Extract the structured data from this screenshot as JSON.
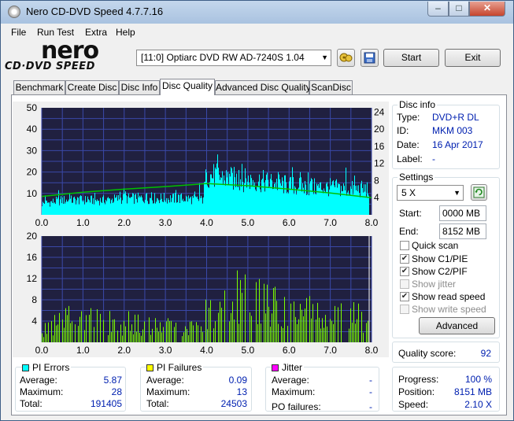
{
  "window": {
    "title": "Nero CD-DVD Speed 4.7.7.16"
  },
  "menu": [
    "File",
    "Run Test",
    "Extra",
    "Help"
  ],
  "logo": {
    "top": "nero",
    "bottom": "CD·DVD SPEED"
  },
  "toolbar": {
    "drive": "[11:0]  Optiarc DVD RW AD-7240S 1.04",
    "start_label": "Start",
    "exit_label": "Exit"
  },
  "tabs": [
    "Benchmark",
    "Create Disc",
    "Disc Info",
    "Disc Quality",
    "Advanced Disc Quality",
    "ScanDisc"
  ],
  "active_tab": "Disc Quality",
  "disc_info": {
    "title": "Disc info",
    "type_label": "Type:",
    "type_value": "DVD+R DL",
    "id_label": "ID:",
    "id_value": "MKM 003",
    "date_label": "Date:",
    "date_value": "16 Apr 2017",
    "label_label": "Label:",
    "label_value": "-"
  },
  "settings": {
    "title": "Settings",
    "speed": "5 X",
    "start_label": "Start:",
    "start_value": "0000 MB",
    "end_label": "End:",
    "end_value": "8152 MB",
    "checks": [
      {
        "label": "Quick scan",
        "checked": false,
        "enabled": true
      },
      {
        "label": "Show C1/PIE",
        "checked": true,
        "enabled": true
      },
      {
        "label": "Show C2/PIF",
        "checked": true,
        "enabled": true
      },
      {
        "label": "Show jitter",
        "checked": false,
        "enabled": false
      },
      {
        "label": "Show read speed",
        "checked": true,
        "enabled": true
      },
      {
        "label": "Show write speed",
        "checked": false,
        "enabled": false
      }
    ],
    "advanced_label": "Advanced"
  },
  "quality": {
    "label": "Quality score:",
    "value": "92"
  },
  "progress": {
    "progress_label": "Progress:",
    "progress_value": "100 %",
    "position_label": "Position:",
    "position_value": "8151 MB",
    "speed_label": "Speed:",
    "speed_value": "2.10 X"
  },
  "stats": {
    "pi_errors": {
      "title": "PI Errors",
      "color": "#00ffff",
      "average_label": "Average:",
      "average": "5.87",
      "maximum_label": "Maximum:",
      "maximum": "28",
      "total_label": "Total:",
      "total": "191405"
    },
    "pi_failures": {
      "title": "PI Failures",
      "color": "#ffff00",
      "average_label": "Average:",
      "average": "0.09",
      "maximum_label": "Maximum:",
      "maximum": "13",
      "total_label": "Total:",
      "total": "24503"
    },
    "jitter": {
      "title": "Jitter",
      "color": "#ff00ff",
      "average_label": "Average:",
      "average": "-",
      "maximum_label": "Maximum:",
      "maximum": "-",
      "po_label": "PO failures:",
      "po_value": "-"
    }
  },
  "chart_data": [
    {
      "type": "area",
      "title": "",
      "x_ticks": [
        "0.0",
        "1.0",
        "2.0",
        "3.0",
        "4.0",
        "5.0",
        "6.0",
        "7.0",
        "8.0"
      ],
      "y_left_ticks": [
        "10",
        "20",
        "30",
        "40",
        "50"
      ],
      "y_right_ticks": [
        "4",
        "8",
        "12",
        "16",
        "20",
        "24"
      ],
      "xlim": [
        0,
        8.0
      ],
      "ylim_left": [
        0,
        50
      ],
      "ylim_right": [
        0,
        25
      ],
      "grid": true,
      "series": [
        {
          "color": "#00ffff",
          "x": [
            0.0,
            0.5,
            1.0,
            1.5,
            2.0,
            2.5,
            3.0,
            3.5,
            3.9,
            4.0,
            4.5,
            5.0,
            5.5,
            6.0,
            6.5,
            7.0,
            7.5,
            8.0
          ],
          "y": [
            6,
            8,
            8,
            8,
            9,
            9,
            9,
            9,
            8,
            22,
            20,
            19,
            18,
            16,
            15,
            15,
            14,
            14
          ]
        },
        {
          "color": "#00c000",
          "x": [
            0.0,
            1.0,
            2.0,
            3.0,
            4.0,
            5.0,
            6.0,
            7.0,
            8.0
          ],
          "y": [
            4.3,
            5.3,
            6.0,
            6.6,
            7.3,
            6.8,
            6.0,
            5.1,
            4.0
          ]
        }
      ]
    },
    {
      "type": "bar",
      "title": "",
      "x_ticks": [
        "0.0",
        "1.0",
        "2.0",
        "3.0",
        "4.0",
        "5.0",
        "6.0",
        "7.0",
        "8.0"
      ],
      "y_ticks": [
        "4",
        "8",
        "12",
        "16",
        "20"
      ],
      "xlim": [
        0,
        8.0
      ],
      "ylim": [
        0,
        20
      ],
      "grid": true,
      "series": [
        {
          "color": "#7cff00",
          "x": [
            0.0,
            0.5,
            1.0,
            1.5,
            2.0,
            2.5,
            3.0,
            3.5,
            3.9,
            4.0,
            4.5,
            5.0,
            5.5,
            6.0,
            6.5,
            7.0,
            7.5,
            8.0
          ],
          "y": [
            2,
            4,
            5,
            4,
            4,
            3,
            3,
            3,
            3,
            6,
            8,
            9,
            7,
            6,
            6,
            5,
            5,
            4
          ]
        }
      ]
    }
  ]
}
